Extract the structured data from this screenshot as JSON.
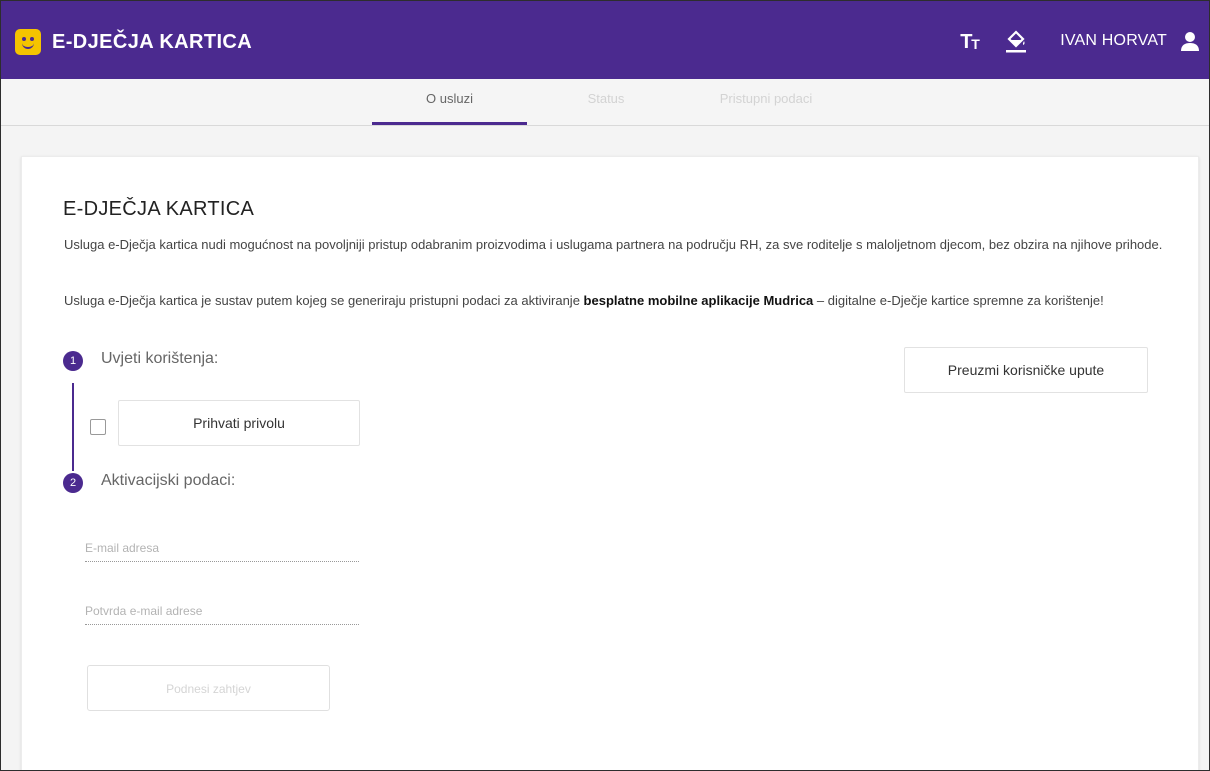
{
  "header": {
    "title": "E-DJEČJA KARTICA",
    "logo_icon": "smiley-logo-icon",
    "text_size_icon": "text-size-icon",
    "theme_icon": "paint-bucket-icon",
    "user_name": "IVAN HORVAT",
    "user_icon": "user-icon",
    "colors": {
      "bar": "#4b2a8f",
      "logo": "#f5c400"
    }
  },
  "tabs": [
    {
      "label": "O usluzi",
      "active": true
    },
    {
      "label": "Status",
      "active": false
    },
    {
      "label": "Pristupni podaci",
      "active": false
    }
  ],
  "main": {
    "heading": "E-DJEČJA KARTICA",
    "paragraph1": "Usluga e-Dječja kartica nudi mogućnost na povoljniji pristup odabranim proizvodima i uslugama partnera na području RH, za sve roditelje s maloljetnom djecom, bez obzira na njihove prihode.",
    "paragraph2_before": "Usluga e-Dječja kartica je sustav putem kojeg se generiraju pristupni podaci za aktiviranje ",
    "paragraph2_bold": "besplatne mobilne aplikacije Mudrica",
    "paragraph2_after": " – digitalne e-Dječje kartice spremne za korištenje!",
    "download_button": "Preuzmi korisničke upute",
    "steps": [
      {
        "number": "1",
        "label": "Uvjeti korištenja:"
      },
      {
        "number": "2",
        "label": "Aktivacijski podaci:"
      }
    ],
    "consent_button": "Prihvati privolu",
    "consent_checked": false,
    "email_placeholder": "E-mail adresa",
    "email_confirm_placeholder": "Potvrda e-mail adrese",
    "submit_button": "Podnesi zahtjev"
  }
}
